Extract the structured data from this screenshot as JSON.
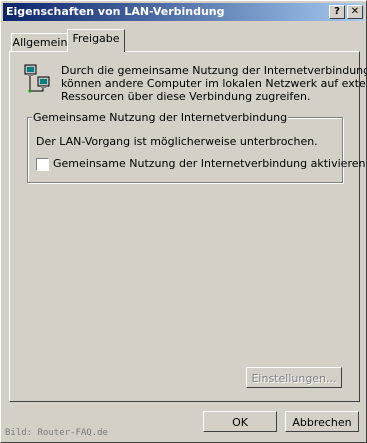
{
  "window": {
    "title": "Eigenschaften von LAN-Verbindung",
    "help_button": "?",
    "close_button": "✕"
  },
  "tabs": [
    {
      "label": "Allgemein",
      "active": false
    },
    {
      "label": "Freigabe",
      "active": true
    }
  ],
  "description": {
    "line1": "Durch die gemeinsame Nutzung der Internetverbindung",
    "line2": "können andere Computer im lokalen Netzwerk auf externe",
    "line3": "Ressourcen über diese Verbindung zugreifen."
  },
  "sharing_group": {
    "title": "Gemeinsame Nutzung der Internetverbindung",
    "status": "Der LAN-Vorgang ist möglicherweise unterbrochen.",
    "checkbox_label": "Gemeinsame Nutzung der Internetverbindung aktivieren",
    "checked": false
  },
  "buttons": {
    "settings": "Einstellungen...",
    "ok": "OK",
    "cancel": "Abbrechen"
  },
  "watermark": "Bild: Router-FAQ.de"
}
